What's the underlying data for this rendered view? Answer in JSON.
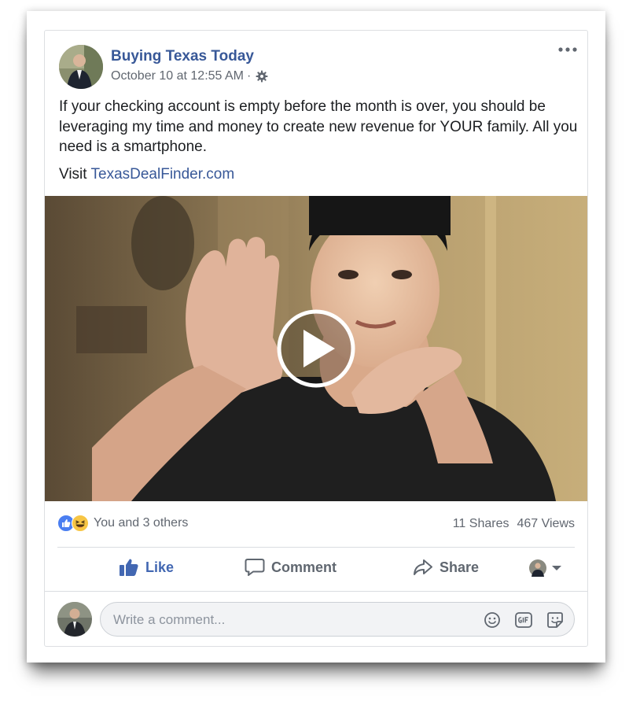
{
  "post": {
    "page_name": "Buying Texas Today",
    "timestamp": "October 10 at 12:55 AM",
    "separator": "·",
    "body_text": "If your checking account is empty before the month is over, you should be leveraging my time and money to create new revenue for YOUR family. All you need is a smartphone.",
    "visit_prefix": "Visit ",
    "link_text": "TexasDealFinder.com"
  },
  "stats": {
    "reactions_text": "You and 3 others",
    "shares": "11 Shares",
    "views": "467 Views"
  },
  "actions": {
    "like": "Like",
    "comment": "Comment",
    "share": "Share"
  },
  "composer": {
    "placeholder": "Write a comment..."
  },
  "icons": {
    "more": "more-horizontal-icon",
    "privacy": "gear-icon",
    "play": "play-icon",
    "like_reaction": "like-reaction-icon",
    "haha_reaction": "haha-reaction-icon",
    "emoji": "emoji-icon",
    "gif": "gif-icon",
    "sticker": "sticker-icon"
  },
  "colors": {
    "link": "#385898",
    "like_active": "#4267b2",
    "muted_text": "#616770"
  }
}
